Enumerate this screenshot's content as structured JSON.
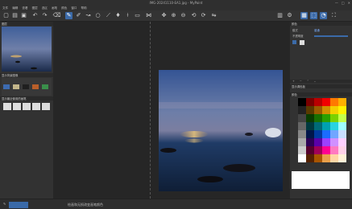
{
  "window": {
    "title": "IMG-20241110-EA1.jpg - MyPaint",
    "controls": [
      "minimize-icon",
      "maximize-icon",
      "close-icon"
    ]
  },
  "menu": [
    "文件",
    "编辑",
    "查看",
    "图层",
    "选区",
    "画笔",
    "颜色",
    "窗口",
    "帮助"
  ],
  "toolbar": [
    "new-icon",
    "open-icon",
    "save-icon",
    "undo-icon",
    "redo-icon",
    "brush-icon",
    "eraser-icon",
    "smudge-icon",
    "line-icon",
    "picker-icon",
    "fill-icon",
    "pan-icon",
    "zoom-icon",
    "transform-icon",
    "symmetry-icon",
    "move-icon",
    "rotate-icon",
    "flip-icon",
    "mirror-icon",
    "layers-icon",
    "fullscreen-icon",
    "settings-icon",
    "lock-icon"
  ],
  "left": {
    "layers_header": "图层",
    "color_header": "显示背景图像",
    "brush_header": "显示最近使用的画笔"
  },
  "right": {
    "panel1": "颜色",
    "label_mode": "模式",
    "label_opacity": "不透明度",
    "value_mode": "普通",
    "panel2": "显示调色板",
    "panel3": "颜色"
  },
  "status": {
    "text": "绘画和无损改变画笔颜色"
  },
  "palette_colors": [
    "#000",
    "#7a0000",
    "#b80000",
    "#f10000",
    "#ff7a00",
    "#ffb000",
    "#222",
    "#5a3a00",
    "#9a5b00",
    "#d09000",
    "#f4d000",
    "#fff200",
    "#444",
    "#0a3c00",
    "#186f00",
    "#2aa000",
    "#7ad200",
    "#c4ff4a",
    "#666",
    "#00393f",
    "#006a77",
    "#00a0b0",
    "#29d3e0",
    "#9effff",
    "#888",
    "#00164a",
    "#003aa0",
    "#1a6cff",
    "#71a6ff",
    "#c9deff",
    "#aaa",
    "#2d0055",
    "#5a00a8",
    "#9c40ff",
    "#d090ff",
    "#ffd0ff",
    "#ccc",
    "#55002c",
    "#a00058",
    "#ff0091",
    "#ff79c1",
    "#ffd1e8",
    "#fff",
    "#552200",
    "#a85500",
    "#e9a04b",
    "#ffd6a5",
    "#fff1d8"
  ]
}
